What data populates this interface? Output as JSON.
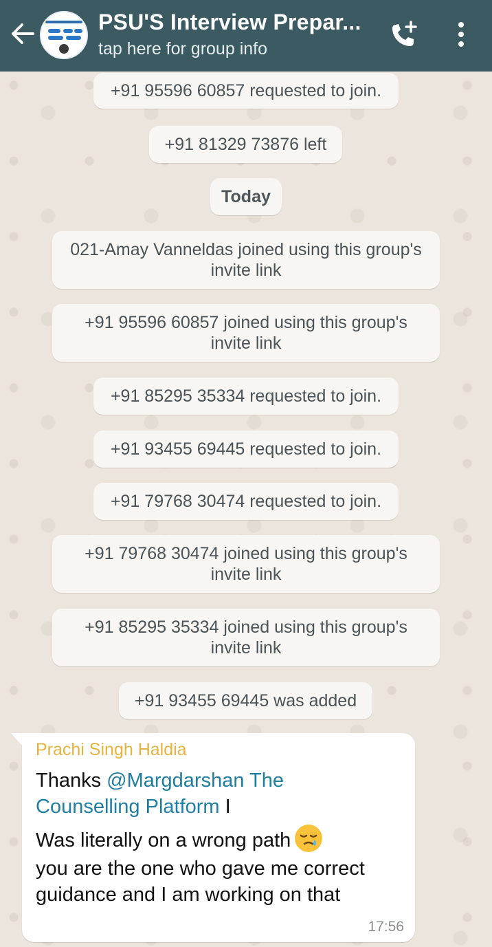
{
  "header": {
    "title": "PSU'S Interview Prepar...",
    "subtitle": "tap here for group info"
  },
  "messages_system": [
    "+91 95596 60857 requested to join.",
    "+91 81329 73876 left",
    "Today",
    "021-Amay Vanneldas joined using this group's invite link",
    "+91 95596 60857 joined using this group's invite link",
    "+91 85295 35334 requested to join.",
    "+91 93455 69445 requested to join.",
    "+91 79768 30474 requested to join.",
    "+91 79768 30474 joined using this group's invite link",
    "+91 85295 35334 joined using this group's invite link",
    "+91 93455 69445 was added"
  ],
  "message": {
    "sender": "Prachi Singh Haldia",
    "line1_prefix": "Thanks ",
    "mention": "@Margdarshan The Counselling Platform",
    "mention_line1": "@Margdarshan The",
    "mention_line2": "Counselling Platform",
    "line2_suffix": " I",
    "line3": "Was literally on a wrong path",
    "line4": "you are the one who gave me correct",
    "line5": "guidance and I am working on that",
    "emoji": "sleepy-face",
    "time": "17:56"
  },
  "colors": {
    "header": "#3c5a61",
    "chat_bg": "#ece5dd",
    "sender": "#e6b33f",
    "mention": "#1e7ea3"
  }
}
